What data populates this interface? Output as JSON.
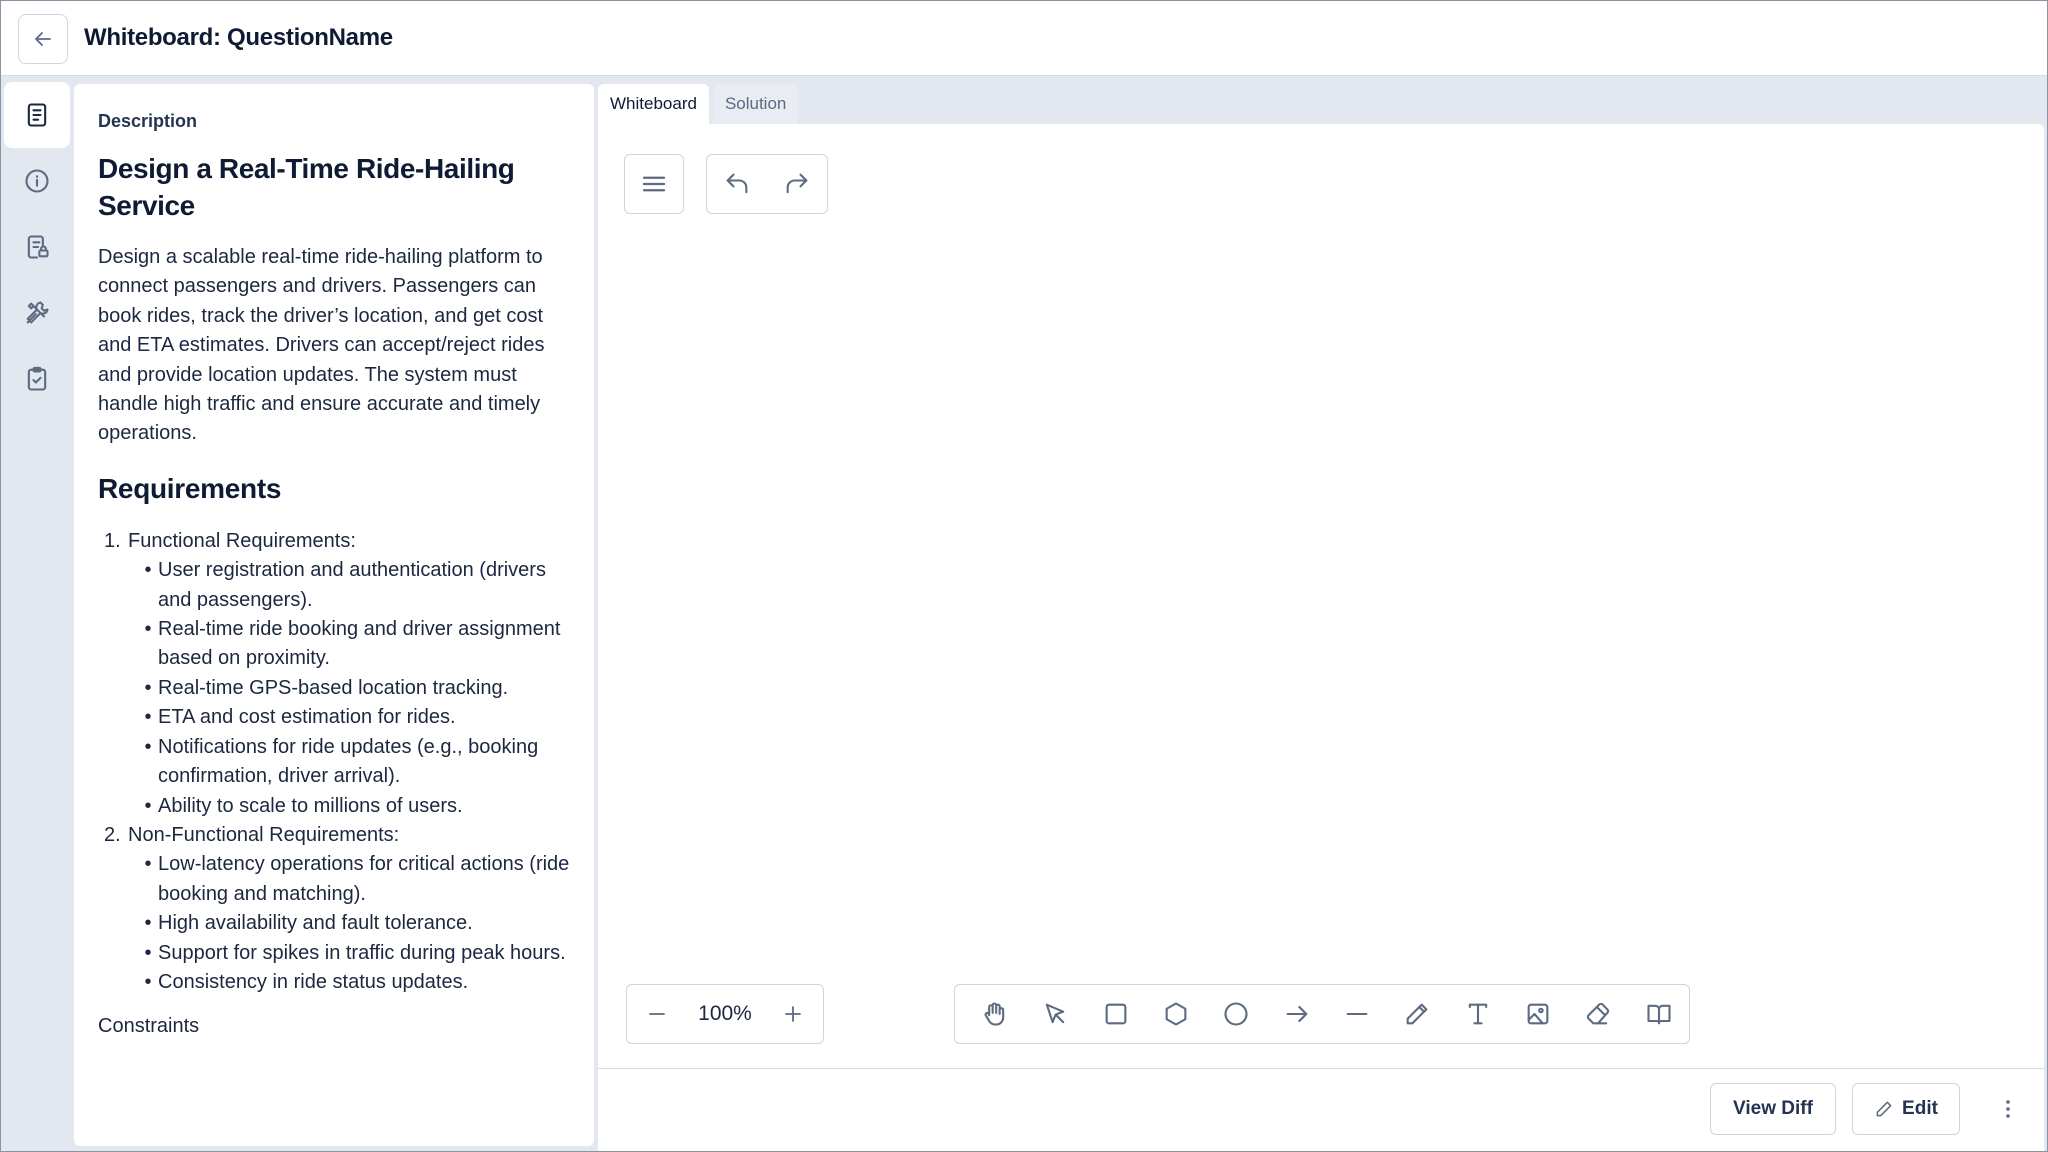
{
  "header": {
    "title": "Whiteboard: QuestionName"
  },
  "rail": {
    "items": [
      {
        "name": "description",
        "icon": "document-icon",
        "active": true
      },
      {
        "name": "info",
        "icon": "info-icon",
        "active": false
      },
      {
        "name": "notes",
        "icon": "document-lock-icon",
        "active": false
      },
      {
        "name": "tools",
        "icon": "tools-icon",
        "active": false
      },
      {
        "name": "checklist",
        "icon": "clipboard-check-icon",
        "active": false
      }
    ]
  },
  "description": {
    "label": "Description",
    "heading": "Design a Real-Time Ride-Hailing Service",
    "body": "Design a scalable real-time ride-hailing platform to connect passengers and drivers. Passengers can book rides, track the driver’s location, and get cost and ETA estimates. Drivers can accept/reject rides and provide location updates. The system must handle high traffic and ensure accurate and timely operations.",
    "requirements_heading": "Requirements",
    "groups": [
      {
        "num": "1.",
        "title": "Functional Requirements:",
        "items": [
          "User registration and authentication (drivers and passengers).",
          "Real-time ride booking and driver assignment based on proximity.",
          "Real-time GPS-based location tracking.",
          "ETA and cost estimation for rides.",
          "Notifications for ride updates (e.g., booking confirmation, driver arrival).",
          "Ability to scale to millions of users."
        ]
      },
      {
        "num": "2.",
        "title": "Non-Functional Requirements:",
        "items": [
          "Low-latency operations for critical actions (ride booking and matching).",
          "High availability and fault tolerance.",
          "Support for spikes in traffic during peak hours.",
          "Consistency in ride status updates."
        ]
      }
    ],
    "constraints_label": "Constraints"
  },
  "tabs": [
    {
      "label": "Whiteboard",
      "active": true
    },
    {
      "label": "Solution",
      "active": false
    }
  ],
  "canvas": {
    "zoom": "100%",
    "tools": [
      "hand-icon",
      "pointer-icon",
      "rectangle-icon",
      "hexagon-icon",
      "circle-icon",
      "arrow-icon",
      "line-icon",
      "pencil-icon",
      "text-icon",
      "image-icon",
      "eraser-icon",
      "library-icon"
    ]
  },
  "footer": {
    "view_diff": "View Diff",
    "edit": "Edit"
  },
  "colors": {
    "background": "#e3e7ef",
    "panel": "#ffffff",
    "text": "#0f1b33",
    "icon": "#5d6a82",
    "border": "#cfd5df"
  }
}
